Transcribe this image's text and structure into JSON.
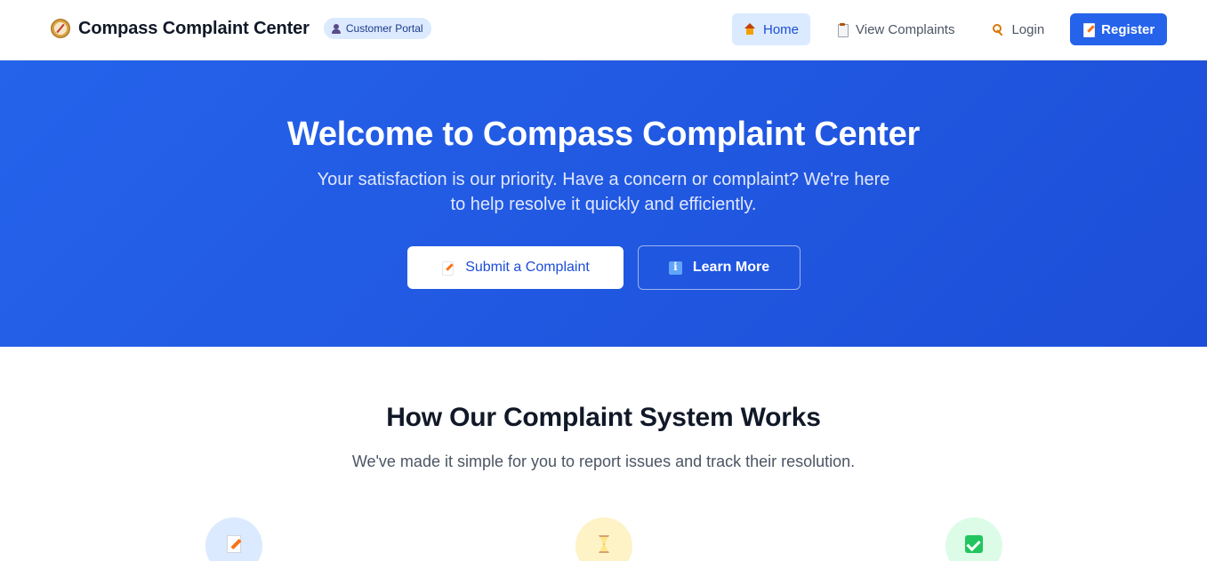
{
  "header": {
    "brand_title": "Compass Complaint Center",
    "badge": "Customer Portal",
    "brand_icon": "compass-icon",
    "nav": [
      {
        "label": "Home",
        "icon": "home-icon",
        "active": true
      },
      {
        "label": "View Complaints",
        "icon": "clipboard-icon",
        "active": false
      },
      {
        "label": "Login",
        "icon": "key-icon",
        "active": false
      }
    ],
    "register_label": "Register"
  },
  "hero": {
    "title": "Welcome to Compass Complaint Center",
    "subtitle": "Your satisfaction is our priority. Have a concern or complaint? We're here to help resolve it quickly and efficiently.",
    "primary_button": "Submit a Complaint",
    "secondary_button": "Learn More"
  },
  "how_it_works": {
    "title": "How Our Complaint System Works",
    "subtitle": "We've made it simple for you to report issues and track their resolution.",
    "steps": [
      {
        "icon": "memo-icon",
        "color": "#dbeafe"
      },
      {
        "icon": "hourglass-icon",
        "color": "#fef3c7"
      },
      {
        "icon": "checkmark-icon",
        "color": "#dcfce7"
      }
    ]
  },
  "colors": {
    "primary": "#2563eb",
    "hero_gradient_end": "#1d4ed8",
    "active_nav_bg": "#dbeafe"
  }
}
